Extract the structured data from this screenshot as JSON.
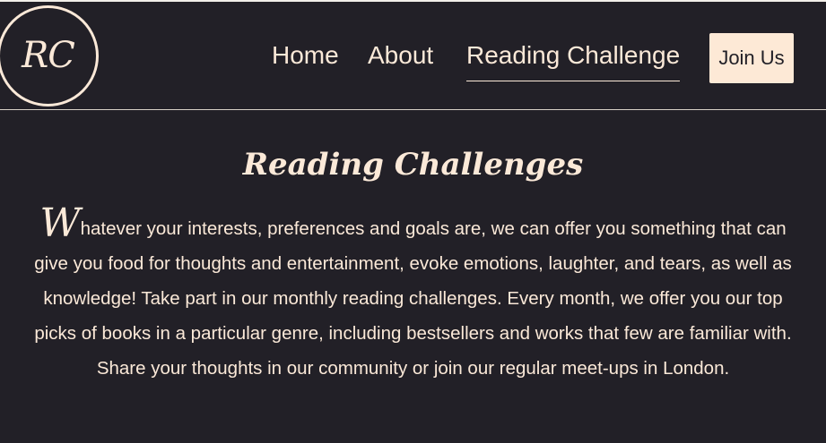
{
  "logo": {
    "text": "RC"
  },
  "nav": {
    "home": "Home",
    "about": "About",
    "reading_challenge": "Reading Challenge",
    "active": "Reading Challenge"
  },
  "header": {
    "join_button": "Join Us"
  },
  "main": {
    "title": "Reading Challenges",
    "intro_drop_cap": "W",
    "intro_text": "hatever your interests, preferences and goals are, we can offer you something that can give you food for thoughts and entertainment, evoke emotions, laughter, and tears, as well as knowledge! Take part in our monthly reading challenges. Every month, we offer you our top picks of books in a particular genre, including bestsellers and works that few are familiar with. Share your thoughts in our community or join our regular meet-ups in London."
  },
  "colors": {
    "background": "#222027",
    "text": "#fbe9d8",
    "button_bg": "#fde9d6",
    "button_text": "#222027"
  }
}
